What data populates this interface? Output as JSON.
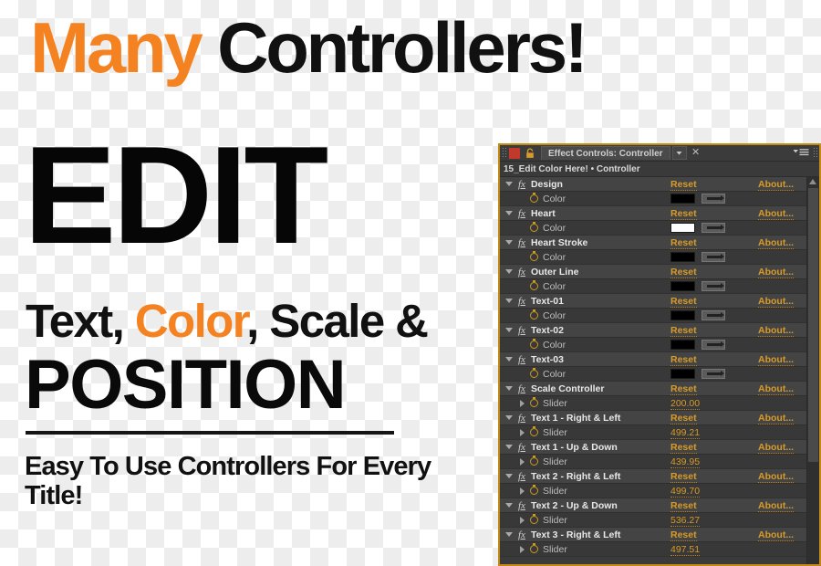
{
  "promo": {
    "headline_1": {
      "part_orange": "Many",
      "part_black": " Controllers!"
    },
    "headline_2": "EDIT",
    "headline_3": {
      "part_1": "Text, ",
      "part_orange": "Color",
      "part_2": ", Scale &"
    },
    "headline_4": "POSITION",
    "tagline": "Easy To Use Controllers For Every Title!",
    "accent_color": "#f58220",
    "text_color": "#111111"
  },
  "panel": {
    "titlebar": {
      "color_label_swatch": "#c0392b",
      "lock_icon": "lock-icon",
      "tab_label": "Effect Controls: Controller",
      "tab_dropdown_icon": "chevron-down-icon",
      "close_icon": "close-icon",
      "panel_menu_icon": "panel-menu-icon"
    },
    "breadcrumb": "15_Edit Color Here! • Controller",
    "columns": {
      "reset": "Reset",
      "about": "About..."
    },
    "fx_label": "fx",
    "scrollbar": {
      "up_arrow_icon": "scroll-up-arrow-icon"
    },
    "effects": [
      {
        "name": "Design",
        "reset": "Reset",
        "about": "About...",
        "property": {
          "name": "Color",
          "type": "color",
          "value": "#000000"
        }
      },
      {
        "name": "Heart",
        "reset": "Reset",
        "about": "About...",
        "property": {
          "name": "Color",
          "type": "color",
          "value": "#ffffff"
        }
      },
      {
        "name": "Heart Stroke",
        "reset": "Reset",
        "about": "About...",
        "property": {
          "name": "Color",
          "type": "color",
          "value": "#000000"
        }
      },
      {
        "name": "Outer Line",
        "reset": "Reset",
        "about": "About...",
        "property": {
          "name": "Color",
          "type": "color",
          "value": "#000000"
        }
      },
      {
        "name": "Text-01",
        "reset": "Reset",
        "about": "About...",
        "property": {
          "name": "Color",
          "type": "color",
          "value": "#000000"
        }
      },
      {
        "name": "Text-02",
        "reset": "Reset",
        "about": "About...",
        "property": {
          "name": "Color",
          "type": "color",
          "value": "#000000"
        }
      },
      {
        "name": "Text-03",
        "reset": "Reset",
        "about": "About...",
        "property": {
          "name": "Color",
          "type": "color",
          "value": "#000000"
        }
      },
      {
        "name": "Scale Controller",
        "reset": "Reset",
        "about": "About...",
        "property": {
          "name": "Slider",
          "type": "slider",
          "value": "200.00"
        }
      },
      {
        "name": "Text 1 - Right & Left",
        "reset": "Reset",
        "about": "About...",
        "property": {
          "name": "Slider",
          "type": "slider",
          "value": "499.21"
        }
      },
      {
        "name": "Text 1 - Up & Down",
        "reset": "Reset",
        "about": "About...",
        "property": {
          "name": "Slider",
          "type": "slider",
          "value": "439.95"
        }
      },
      {
        "name": "Text 2 - Right & Left",
        "reset": "Reset",
        "about": "About...",
        "property": {
          "name": "Slider",
          "type": "slider",
          "value": "499.70"
        }
      },
      {
        "name": "Text 2 - Up & Down",
        "reset": "Reset",
        "about": "About...",
        "property": {
          "name": "Slider",
          "type": "slider",
          "value": "536.27"
        }
      },
      {
        "name": "Text 3 - Right & Left",
        "reset": "Reset",
        "about": "About...",
        "property": {
          "name": "Slider",
          "type": "slider",
          "value": "497.51"
        }
      }
    ]
  }
}
